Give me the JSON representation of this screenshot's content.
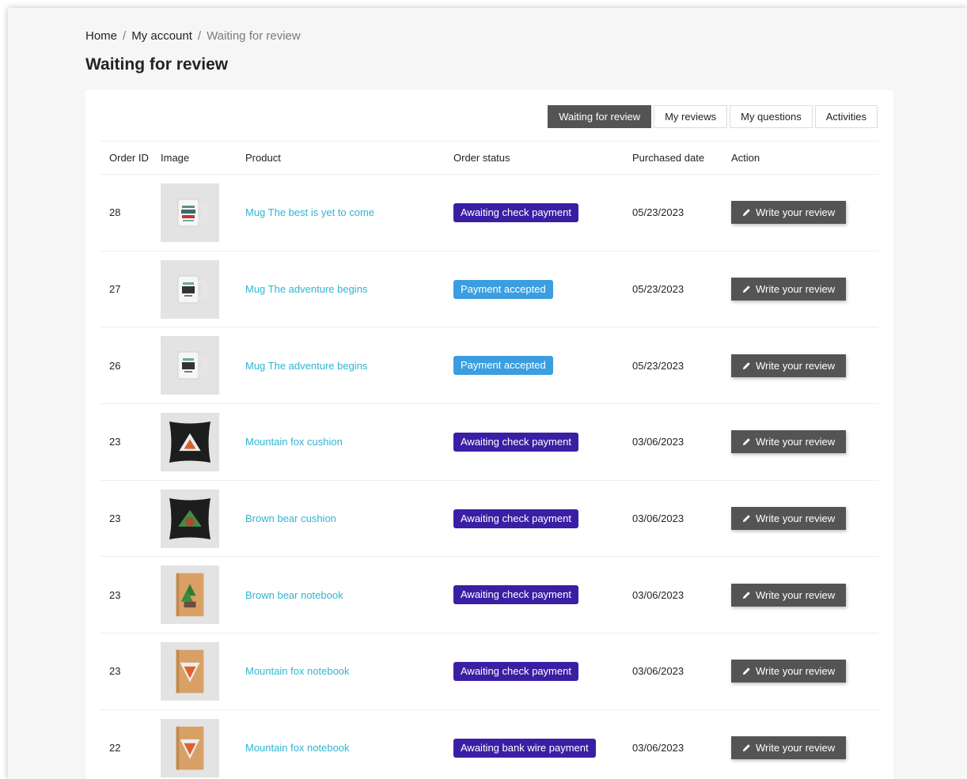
{
  "breadcrumb": {
    "home": "Home",
    "account": "My account",
    "current": "Waiting for review",
    "separator": "/"
  },
  "page_title": "Waiting for review",
  "tabs": [
    {
      "label": "Waiting for review",
      "active": true
    },
    {
      "label": "My reviews",
      "active": false
    },
    {
      "label": "My questions",
      "active": false
    },
    {
      "label": "Activities",
      "active": false
    }
  ],
  "columns": {
    "order_id": "Order ID",
    "image": "Image",
    "product": "Product",
    "order_status": "Order status",
    "purchased_date": "Purchased date",
    "action": "Action"
  },
  "colors": {
    "status_awaiting": "#3a1fa4",
    "status_accepted": "#3a9ee0",
    "link": "#2fb5d2",
    "button": "#545454"
  },
  "rows": [
    {
      "order_id": "28",
      "product": "Mug The best is yet to come",
      "thumb": "mug-best",
      "status": "Awaiting check payment",
      "status_kind": "purple",
      "date": "05/23/2023",
      "action": "Write your review"
    },
    {
      "order_id": "27",
      "product": "Mug The adventure begins",
      "thumb": "mug-adventure",
      "status": "Payment accepted",
      "status_kind": "blue",
      "date": "05/23/2023",
      "action": "Write your review"
    },
    {
      "order_id": "26",
      "product": "Mug The adventure begins",
      "thumb": "mug-adventure",
      "status": "Payment accepted",
      "status_kind": "blue",
      "date": "05/23/2023",
      "action": "Write your review"
    },
    {
      "order_id": "23",
      "product": "Mountain fox cushion",
      "thumb": "cushion-fox",
      "status": "Awaiting check payment",
      "status_kind": "purple",
      "date": "03/06/2023",
      "action": "Write your review"
    },
    {
      "order_id": "23",
      "product": "Brown bear cushion",
      "thumb": "cushion-bear",
      "status": "Awaiting check payment",
      "status_kind": "purple",
      "date": "03/06/2023",
      "action": "Write your review"
    },
    {
      "order_id": "23",
      "product": "Brown bear notebook",
      "thumb": "notebook-bear",
      "status": "Awaiting check payment",
      "status_kind": "purple",
      "date": "03/06/2023",
      "action": "Write your review"
    },
    {
      "order_id": "23",
      "product": "Mountain fox notebook",
      "thumb": "notebook-fox",
      "status": "Awaiting check payment",
      "status_kind": "purple",
      "date": "03/06/2023",
      "action": "Write your review"
    },
    {
      "order_id": "22",
      "product": "Mountain fox notebook",
      "thumb": "notebook-fox",
      "status": "Awaiting bank wire payment",
      "status_kind": "purple",
      "date": "03/06/2023",
      "action": "Write your review"
    }
  ]
}
